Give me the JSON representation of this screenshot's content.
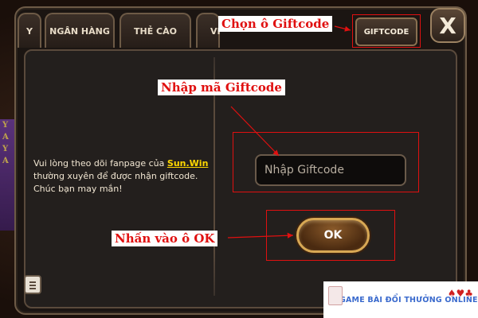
{
  "tabs": [
    {
      "label": "Y"
    },
    {
      "label": "NGÂN HÀNG"
    },
    {
      "label": "THẺ CÀO"
    },
    {
      "label": "VI"
    }
  ],
  "giftcode_tab": {
    "label": "GIFTCODE"
  },
  "close": {
    "symbol": "X"
  },
  "info": {
    "line1_prefix": "Vui lòng theo dõi fanpage của ",
    "brand": "Sun.Win",
    "line2": "thường xuyên để được nhận giftcode.",
    "line3": "Chúc bạn may mắn!"
  },
  "input": {
    "placeholder": "Nhập Giftcode"
  },
  "ok_button": {
    "label": "OK"
  },
  "annotations": {
    "select_tab": "Chọn ô Giftcode",
    "enter_code": "Nhập mã Giftcode",
    "press_ok": "Nhấn vào ô OK"
  },
  "watermark": {
    "text": "GAME BÀI ĐỔI THƯỞNG ONLINE",
    "suits": "♠♥♣"
  },
  "background_strip": [
    "Y",
    "A",
    "Y",
    "A"
  ],
  "colors": {
    "annotation": "#e01010",
    "brand": "#ffd800",
    "button_border": "#d8a854"
  }
}
